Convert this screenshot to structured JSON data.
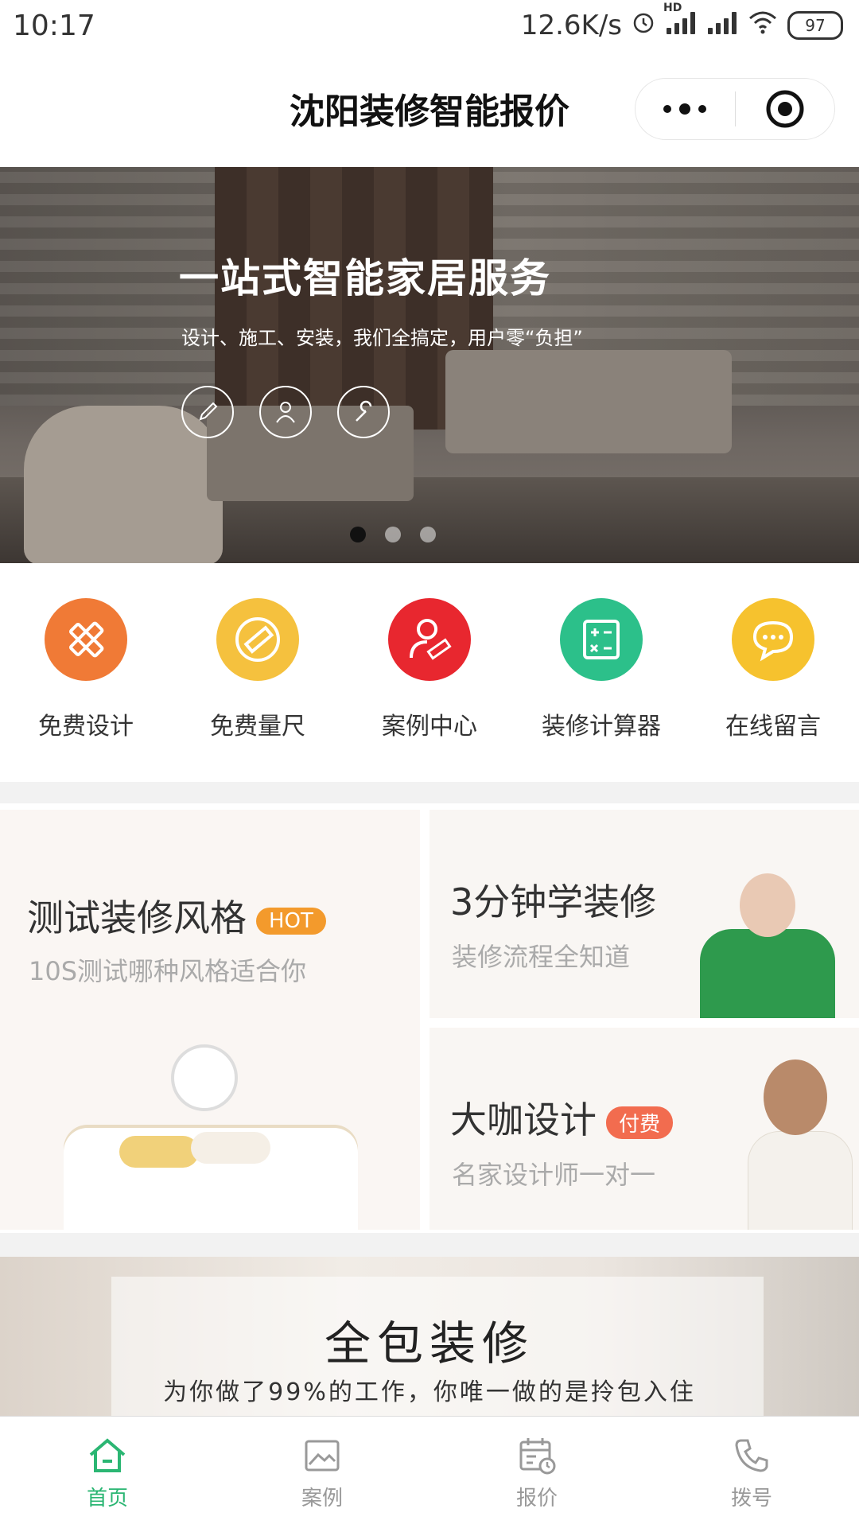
{
  "status_bar": {
    "time": "10:17",
    "speed": "12.6K/s",
    "hd": "HD",
    "battery": "97"
  },
  "nav": {
    "title": "沈阳装修智能报价"
  },
  "banner": {
    "title": "一站式智能家居服务",
    "subtitle": "设计、施工、安装，我们全搞定，用户零“负担”",
    "icons": [
      "pencil-icon",
      "person-icon",
      "wrench-icon"
    ],
    "active_slide": 1,
    "slide_count": 3
  },
  "quick_actions": [
    {
      "label": "免费设计",
      "icon": "ruler-pencil-icon",
      "color": "#f07a36"
    },
    {
      "label": "免费量尺",
      "icon": "ruler-no-icon",
      "color": "#f5c13e"
    },
    {
      "label": "案例中心",
      "icon": "user-ruler-icon",
      "color": "#e8272f"
    },
    {
      "label": "装修计算器",
      "icon": "calculator-icon",
      "color": "#2cc08a"
    },
    {
      "label": "在线留言",
      "icon": "chat-bubble-icon",
      "color": "#f6c22e"
    }
  ],
  "cards": {
    "style_test": {
      "title": "测试装修风格",
      "tag": "HOT",
      "subtitle": "10S测试哪种风格适合你"
    },
    "learn": {
      "title": "3分钟学装修",
      "subtitle": "装修流程全知道"
    },
    "designer": {
      "title": "大咖设计",
      "tag": "付费",
      "subtitle": "名家设计师一对一"
    }
  },
  "promo": {
    "title": "全包装修",
    "subtitle": "为你做了99%的工作，你唯一做的是拎包入住"
  },
  "tabs": [
    {
      "label": "首页",
      "icon": "home-icon",
      "active": true
    },
    {
      "label": "案例",
      "icon": "image-icon",
      "active": false
    },
    {
      "label": "报价",
      "icon": "calendar-icon",
      "active": false
    },
    {
      "label": "拨号",
      "icon": "phone-icon",
      "active": false
    }
  ],
  "colors": {
    "accent": "#2bb673",
    "hot_tag": "#f39a2c",
    "paid_tag": "#f26c4f"
  }
}
